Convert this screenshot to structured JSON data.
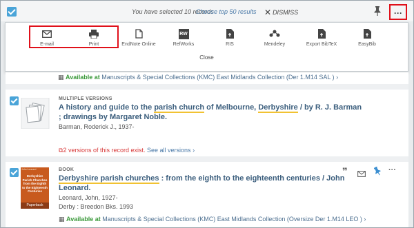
{
  "selection": {
    "text": "You have selected 10 records",
    "choose": "Choose top 50 results",
    "dismiss": "DISMISS"
  },
  "panel": {
    "actions": [
      {
        "label": "E-mail",
        "icon": "email-icon"
      },
      {
        "label": "Print",
        "icon": "print-icon"
      },
      {
        "label": "EndNote Online",
        "icon": "document-icon"
      },
      {
        "label": "RefWorks",
        "icon": "refworks-icon"
      },
      {
        "label": "RIS",
        "icon": "export-file-icon"
      },
      {
        "label": "Mendeley",
        "icon": "mendeley-icon"
      },
      {
        "label": "Export BibTeX",
        "icon": "export-file-icon"
      },
      {
        "label": "EasyBib",
        "icon": "export-file-icon"
      }
    ],
    "close": "Close",
    "icon_rw": "RW"
  },
  "results": {
    "prev_availability": {
      "status": "Available at",
      "location": "Manuscripts & Special Collections (KMC)  East Midlands Collection (Der 1.M14 SAL )",
      "chevron": "›"
    },
    "record1": {
      "type": "MULTIPLE VERSIONS",
      "title_parts": [
        "A history and guide to the ",
        "parish church",
        " of Melbourne, ",
        "Derbyshire",
        " / by R. J. Barman"
      ],
      "title_line2": "; drawings by Margaret Noble.",
      "author": "Barman, Roderick J., 1937-",
      "versions": "2 versions of this record exist.",
      "see_all": "See all versions",
      "chevron": "›"
    },
    "record2": {
      "type": "BOOK",
      "title_hl": "Derbyshire parish churches",
      "title_rest": " : from the eighth to the eighteenth centuries / John",
      "title_line2": "Leonard.",
      "author": "Leonard, John, 1927-",
      "publisher": "Derby : Breedon Bks. 1993",
      "availability_status": "Available at",
      "availability_location": "Manuscripts & Special Collections (KMC)  East Midlands Collection (Oversize Der 1.M14 LEO )",
      "chevron": "›",
      "cover": {
        "top": "John Leonard",
        "main": "Derbyshire Parish Churches from the Eighth to the Eighteenth Centuries",
        "bottom": "Paperback"
      }
    }
  },
  "colors": {
    "accent": "#4aa4d8",
    "link": "#3b5e7d",
    "highlight_box": "#e0101a",
    "available": "#3c9a3c",
    "versions": "#d83b3b"
  }
}
